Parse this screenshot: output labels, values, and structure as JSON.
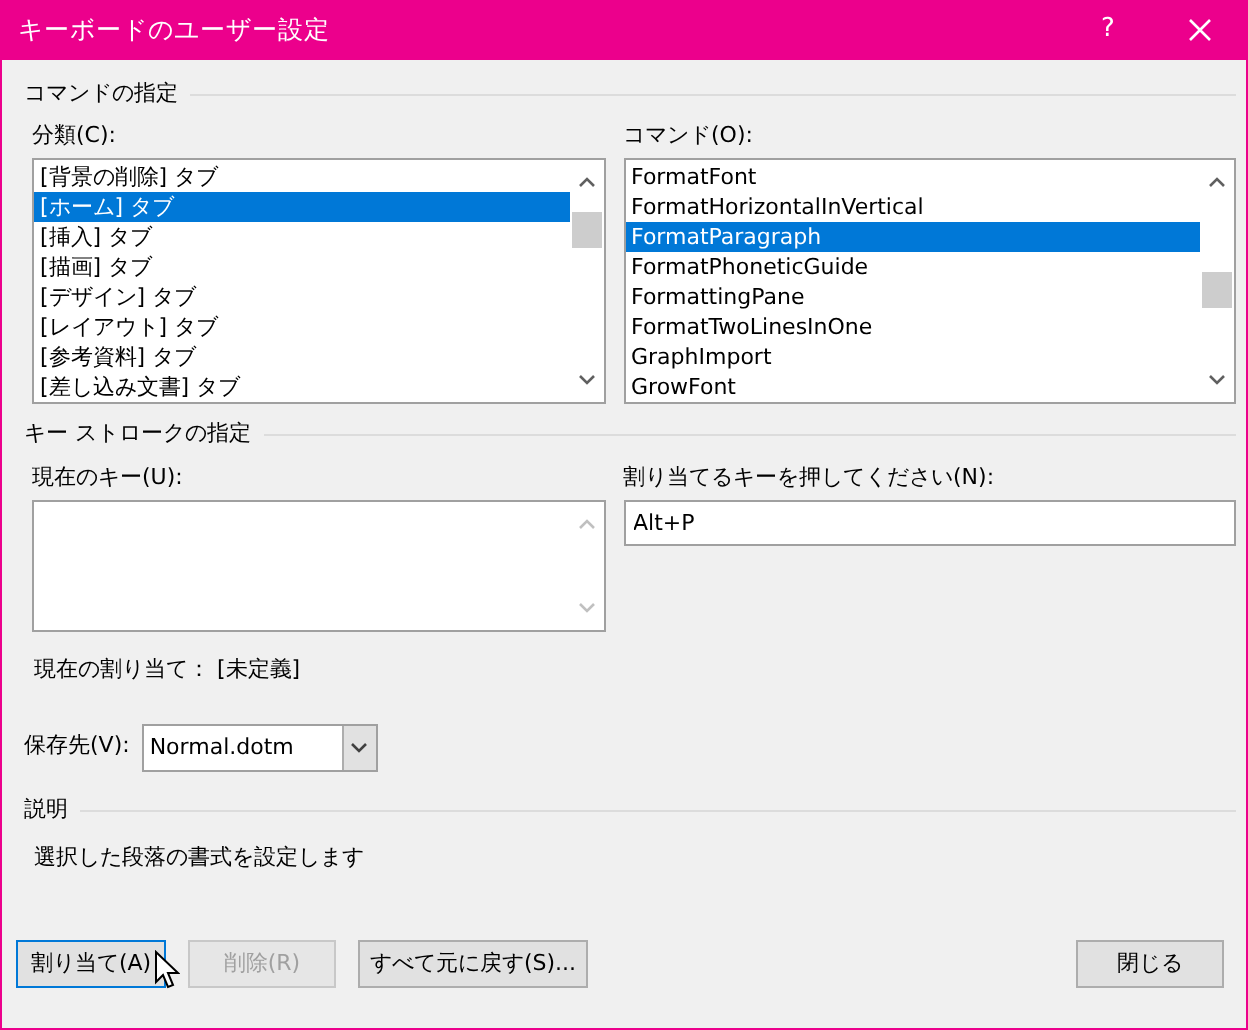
{
  "window": {
    "title": "キーボードのユーザー設定",
    "help": "?"
  },
  "command_section": {
    "heading": "コマンドの指定",
    "categories": {
      "label": "分類(C):",
      "items": [
        {
          "text": "[背景の削除] タブ",
          "selected": false
        },
        {
          "text": "[ホーム] タブ",
          "selected": true
        },
        {
          "text": "[挿入] タブ",
          "selected": false
        },
        {
          "text": "[描画] タブ",
          "selected": false
        },
        {
          "text": "[デザイン] タブ",
          "selected": false
        },
        {
          "text": "[レイアウト] タブ",
          "selected": false
        },
        {
          "text": "[参考資料] タブ",
          "selected": false
        },
        {
          "text": "[差し込み文書] タブ",
          "selected": false
        }
      ]
    },
    "commands": {
      "label": "コマンド(O):",
      "items": [
        {
          "text": "FormatFont",
          "selected": false
        },
        {
          "text": "FormatHorizontalInVertical",
          "selected": false
        },
        {
          "text": "FormatParagraph",
          "selected": true
        },
        {
          "text": "FormatPhoneticGuide",
          "selected": false
        },
        {
          "text": "FormattingPane",
          "selected": false
        },
        {
          "text": "FormatTwoLinesInOne",
          "selected": false
        },
        {
          "text": "GraphImport",
          "selected": false
        },
        {
          "text": "GrowFont",
          "selected": false
        }
      ]
    }
  },
  "keystroke_section": {
    "heading": "キー ストロークの指定",
    "current_keys_label": "現在のキー(U):",
    "new_key_label": "割り当てるキーを押してください(N):",
    "new_key_value": "Alt+P",
    "current_assignment": "現在の割り当て： [未定義]",
    "save_in_label": "保存先(V):",
    "save_in_value": "Normal.dotm"
  },
  "description_section": {
    "heading": "説明",
    "text": "選択した段落の書式を設定します"
  },
  "buttons": [
    {
      "label": "割り当て(A)",
      "disabled": false,
      "focused": true
    },
    {
      "label": "削除(R)",
      "disabled": true,
      "focused": false
    },
    {
      "label": "すべて元に戻す(S)...",
      "disabled": false,
      "focused": false
    }
  ],
  "close_button": "閉じる"
}
